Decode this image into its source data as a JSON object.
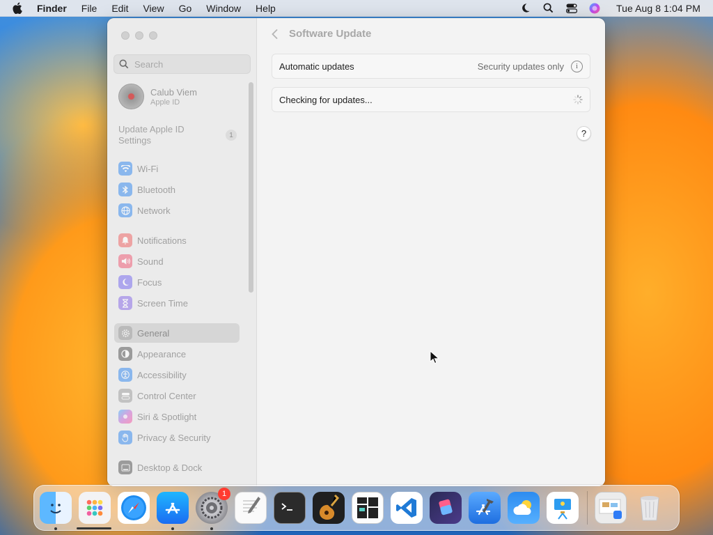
{
  "menubar": {
    "app_name": "Finder",
    "menus": [
      "File",
      "Edit",
      "View",
      "Go",
      "Window",
      "Help"
    ],
    "clock": "Tue Aug 8  1:04 PM"
  },
  "sidebar": {
    "search_placeholder": "Search",
    "account": {
      "name": "Calub Viem",
      "subtitle": "Apple ID"
    },
    "update_apple_id": {
      "label": "Update Apple ID Settings",
      "badge": "1"
    },
    "groups": [
      [
        {
          "label": "Wi-Fi",
          "icon": "wifi-icon",
          "color": "#3b8df0"
        },
        {
          "label": "Bluetooth",
          "icon": "bluetooth-icon",
          "color": "#3b8df0"
        },
        {
          "label": "Network",
          "icon": "globe-icon",
          "color": "#3b8df0"
        }
      ],
      [
        {
          "label": "Notifications",
          "icon": "bell-icon",
          "color": "#f06a6a"
        },
        {
          "label": "Sound",
          "icon": "speaker-icon",
          "color": "#f0607a"
        },
        {
          "label": "Focus",
          "icon": "moon-icon",
          "color": "#7b6ef0"
        },
        {
          "label": "Screen Time",
          "icon": "hourglass-icon",
          "color": "#8b6ee8"
        }
      ],
      [
        {
          "label": "General",
          "icon": "gear-icon",
          "color": "#a8a8a8",
          "selected": true
        },
        {
          "label": "Appearance",
          "icon": "appearance-icon",
          "color": "#5a5a5a"
        },
        {
          "label": "Accessibility",
          "icon": "accessibility-icon",
          "color": "#3b8df0"
        },
        {
          "label": "Control Center",
          "icon": "control-center-icon",
          "color": "#a8a8a8"
        },
        {
          "label": "Siri & Spotlight",
          "icon": "siri-icon",
          "color": "#c66bd6"
        },
        {
          "label": "Privacy & Security",
          "icon": "hand-icon",
          "color": "#3b8df0"
        }
      ],
      [
        {
          "label": "Desktop & Dock",
          "icon": "dock-icon",
          "color": "#5a5a5a"
        }
      ]
    ]
  },
  "content": {
    "title": "Software Update",
    "automatic_updates": {
      "label": "Automatic updates",
      "value": "Security updates only"
    },
    "checking": {
      "label": "Checking for updates..."
    },
    "help": "?"
  },
  "dock": {
    "apps": [
      {
        "name": "finder-app",
        "color": "#4aa3f3",
        "running": true
      },
      {
        "name": "launchpad-app",
        "color": "#f1f1f1",
        "running": false
      },
      {
        "name": "safari-app",
        "color": "#ffffff",
        "running": false
      },
      {
        "name": "app-store-app",
        "color": "#2f7cf6",
        "running": true
      },
      {
        "name": "system-settings-app",
        "color": "#8e8e93",
        "running": true,
        "badge": "1"
      },
      {
        "name": "textedit-app",
        "color": "#f4f4f4",
        "running": false
      },
      {
        "name": "terminal-app",
        "color": "#2b2b2b",
        "running": false
      },
      {
        "name": "garageband-app",
        "color": "#2a2a2a",
        "running": false
      },
      {
        "name": "mosaic-app",
        "color": "#f7f7f7",
        "running": false
      },
      {
        "name": "vscode-app",
        "color": "#ffffff",
        "running": false
      },
      {
        "name": "shortcuts-app",
        "color": "#3d3d6b",
        "running": false
      },
      {
        "name": "xcode-app",
        "color": "#3b8df0",
        "running": false
      },
      {
        "name": "weather-app",
        "color": "#2e8ef5",
        "running": false
      },
      {
        "name": "keynote-app",
        "color": "#ffffff",
        "running": false
      }
    ],
    "right": [
      {
        "name": "downloads-stack",
        "color": "#e8e8e8"
      },
      {
        "name": "trash-app",
        "color": "#e4e4e4"
      }
    ]
  }
}
